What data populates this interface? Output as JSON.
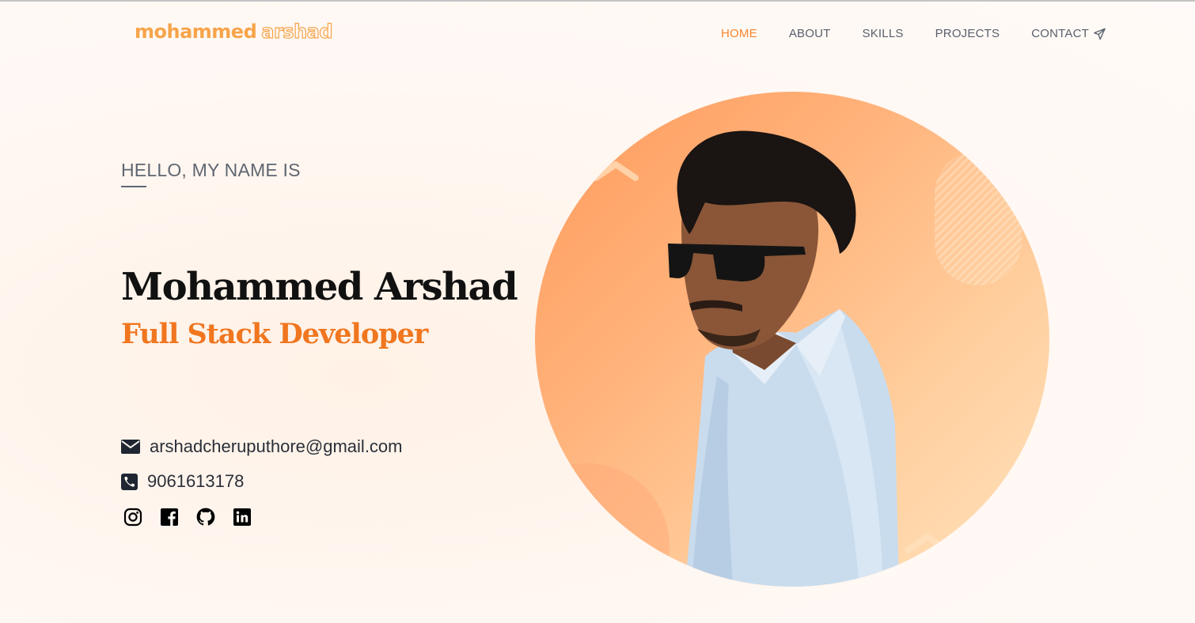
{
  "nav": {
    "logo_first": "mohammed",
    "logo_second": "arshad",
    "items": [
      {
        "label": "HOME",
        "active": true
      },
      {
        "label": "ABOUT",
        "active": false
      },
      {
        "label": "SKILLS",
        "active": false
      },
      {
        "label": "PROJECTS",
        "active": false
      },
      {
        "label": "CONTACT",
        "active": false,
        "icon": "paper-plane-icon"
      }
    ]
  },
  "hero": {
    "greeting": "HELLO, MY NAME IS",
    "name": "Mohammed Arshad",
    "role": "Full Stack Developer",
    "email": "arshadcheruputhore@gmail.com",
    "phone": "9061613178",
    "email_icon": "envelope-icon",
    "phone_icon": "phone-icon",
    "socials": [
      "instagram-icon",
      "facebook-icon",
      "github-icon",
      "linkedin-icon"
    ]
  },
  "colors": {
    "accent": "#f0761f",
    "logo": "#f7a44a",
    "nav_text": "#585f6b",
    "background": "#fff8f3"
  }
}
